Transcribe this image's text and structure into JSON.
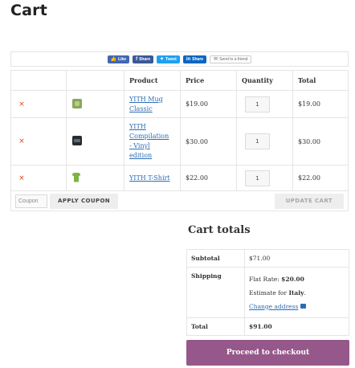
{
  "page": {
    "title": "Cart"
  },
  "share": {
    "like": "Like",
    "share": "Share",
    "tweet": "Tweet",
    "linkedin": "Share",
    "email": "Send to a friend"
  },
  "table": {
    "headers": {
      "product": "Product",
      "price": "Price",
      "quantity": "Quantity",
      "total": "Total"
    },
    "items": [
      {
        "thumb": "mug-thumbnail",
        "name_lines": [
          "YITH Mug",
          "Classic"
        ],
        "price": "$19.00",
        "quantity": "1",
        "total": "$19.00"
      },
      {
        "thumb": "compilation-thumbnail",
        "name_lines": [
          "YITH",
          "Compilation",
          "- Vinyl",
          "edition"
        ],
        "price": "$30.00",
        "quantity": "1",
        "total": "$30.00"
      },
      {
        "thumb": "tshirt-thumbnail",
        "name_lines": [
          "YITH T-Shirt"
        ],
        "price": "$22.00",
        "quantity": "1",
        "total": "$22.00"
      }
    ],
    "remove_icon": "×"
  },
  "actions": {
    "coupon_placeholder": "Coupon",
    "apply_coupon": "APPLY COUPON",
    "update_cart": "UPDATE CART"
  },
  "totals": {
    "title": "Cart totals",
    "subtotal_label": "Subtotal",
    "subtotal_value": "$71.00",
    "shipping_label": "Shipping",
    "shipping_rate_label": "Flat Rate:",
    "shipping_rate_value": "$20.00",
    "estimate_prefix": "Estimate for",
    "estimate_country": "Italy",
    "estimate_suffix": ".",
    "change_address": "Change address",
    "total_label": "Total",
    "total_value": "$91.00"
  },
  "checkout": {
    "label": "Proceed to checkout"
  },
  "colors": {
    "accent_purple": "#96588a",
    "link_blue": "#2c6db5",
    "remove_red": "#e2401c"
  }
}
